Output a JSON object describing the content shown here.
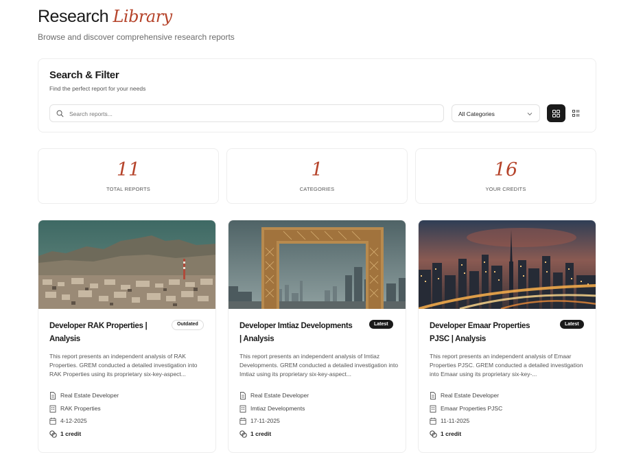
{
  "header": {
    "title_main": "Research",
    "title_accent": "Library",
    "subtitle": "Browse and discover comprehensive research reports"
  },
  "filter": {
    "title": "Search & Filter",
    "subtitle": "Find the perfect report for your needs",
    "search_placeholder": "Search reports...",
    "search_value": "",
    "category_selected": "All Categories",
    "view_mode": "grid"
  },
  "stats": [
    {
      "value": "11",
      "label": "TOTAL REPORTS"
    },
    {
      "value": "1",
      "label": "CATEGORIES"
    },
    {
      "value": "16",
      "label": "YOUR CREDITS"
    }
  ],
  "reports": [
    {
      "title": "Developer RAK Properties | Analysis",
      "badge": "Outdated",
      "description": "This report presents an independent analysis of RAK Properties. GREM conducted a detailed investigation into RAK Properties using its proprietary six-key-aspect...",
      "category": "Real Estate Developer",
      "company": "RAK Properties",
      "date": "4-12-2025",
      "credits": "1 credit",
      "image": "mountain-city-landscape"
    },
    {
      "title": "Developer Imtiaz Developments | Analysis",
      "badge": "Latest",
      "description": "This report presents an independent analysis of Imtiaz Developments. GREM conducted a detailed investigation into Imtiaz using its proprietary six-key-aspect...",
      "category": "Real Estate Developer",
      "company": "Imtiaz Developments",
      "date": "17-11-2025",
      "credits": "1 credit",
      "image": "dubai-frame"
    },
    {
      "title": "Developer Emaar Properties PJSC | Analysis",
      "badge": "Latest",
      "description": "This report presents an independent analysis of Emaar Properties PJSC. GREM conducted a detailed investigation into Emaar using its proprietary six-key-...",
      "category": "Real Estate Developer",
      "company": "Emaar Properties PJSC",
      "date": "11-11-2025",
      "credits": "1 credit",
      "image": "dubai-skyline-night"
    }
  ],
  "colors": {
    "accent": "#b5432a",
    "dark": "#1a1a1a",
    "muted": "#6b6b6b",
    "border": "#ededed"
  }
}
